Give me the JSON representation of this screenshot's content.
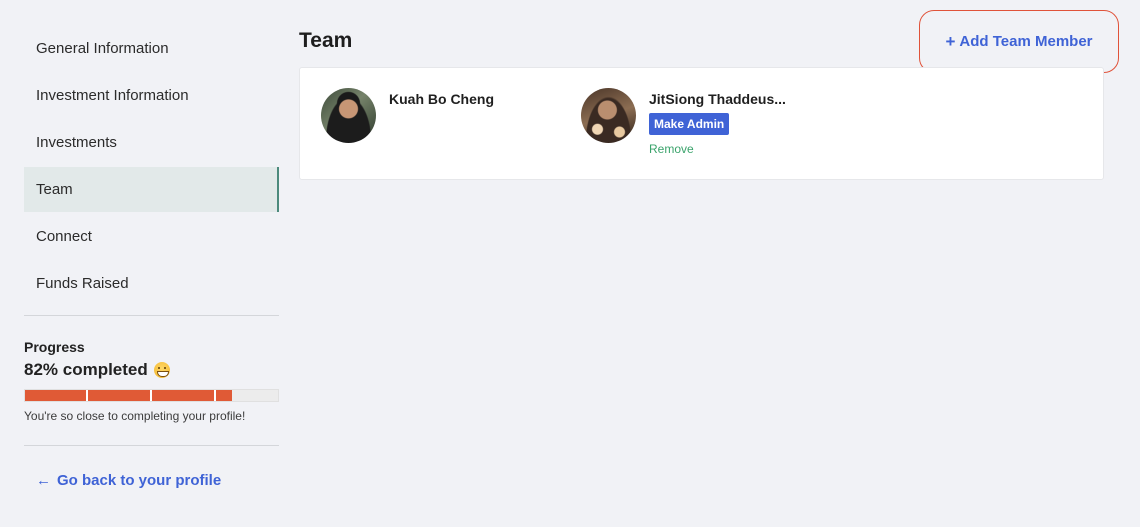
{
  "sidebar": {
    "items": [
      {
        "label": "General Information"
      },
      {
        "label": "Investment Information"
      },
      {
        "label": "Investments"
      },
      {
        "label": "Team"
      },
      {
        "label": "Connect"
      },
      {
        "label": "Funds Raised"
      }
    ],
    "active_item": "Team"
  },
  "progress": {
    "label": "Progress",
    "value_text": "82% completed",
    "percent": 82,
    "emoji": "grinning-face-icon",
    "message": "You're so close to completing your profile!",
    "bar_color": "#e05a36"
  },
  "back_link": {
    "icon": "arrow-left-icon",
    "label": "Go back to your profile"
  },
  "main": {
    "title": "Team",
    "add_button": {
      "icon": "plus-icon",
      "label": "Add Team Member"
    },
    "members": [
      {
        "name": "Kuah Bo Cheng"
      },
      {
        "name": "JitSiong Thaddeus...",
        "make_admin_label": "Make Admin",
        "remove_label": "Remove"
      }
    ]
  },
  "colors": {
    "accent": "#3f63d6",
    "highlight_outline": "#e0533a",
    "remove": "#3aa36b",
    "active_nav_border": "#4c8a7c"
  }
}
